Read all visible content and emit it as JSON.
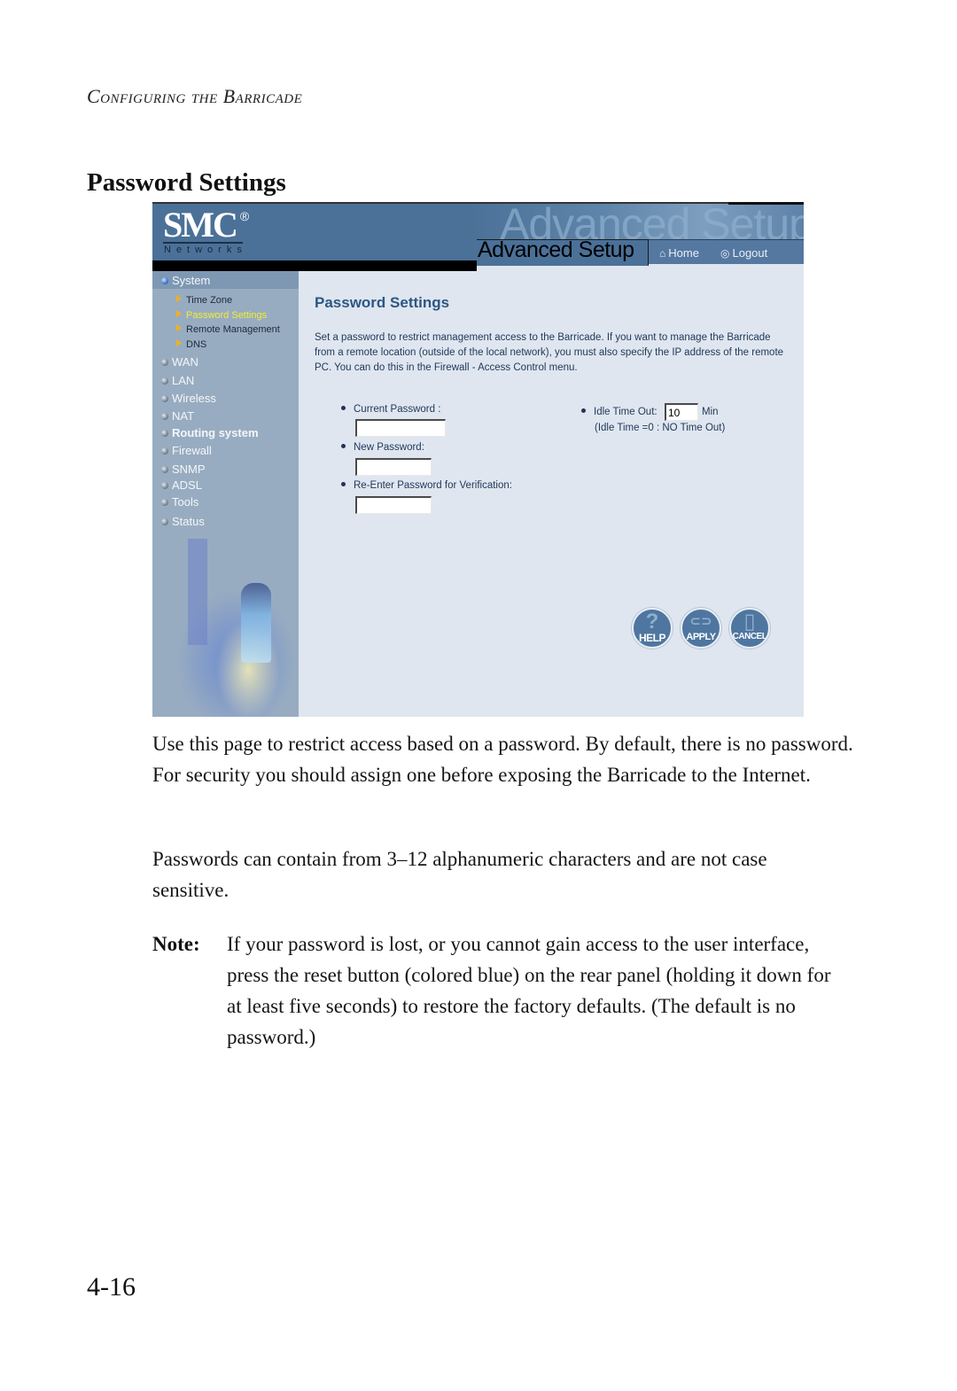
{
  "document": {
    "running_header": "Configuring the Barricade",
    "section_title": "Password Settings",
    "page_number": "4-16",
    "paragraphs": [
      "Use this page to restrict access based on a password. By default, there is no password. For security you should assign one before exposing the Barricade to the Internet.",
      "Passwords can contain from 3–12 alphanumeric characters and are not case sensitive."
    ],
    "note": {
      "label": "Note:",
      "text": "If your password is lost, or you cannot gain access to the user interface, press the reset button (colored blue) on the rear panel (holding it down for at least five seconds) to restore the factory defaults. (The default is no password.)"
    }
  },
  "screenshot": {
    "logo": {
      "brand": "SMC",
      "registered": "®",
      "subtitle": "Networks"
    },
    "banner_watermark": "Advanced Setup",
    "banner_title": "Advanced Setup",
    "top_nav": [
      {
        "label": "Home",
        "icon": "home-icon"
      },
      {
        "label": "Logout",
        "icon": "logout-icon"
      }
    ],
    "sidebar": {
      "sections": [
        {
          "label": "System",
          "bullet": "blue",
          "bold": false
        },
        {
          "label": "WAN",
          "bold": false
        },
        {
          "label": "LAN",
          "bold": false
        },
        {
          "label": "Wireless",
          "bold": false
        },
        {
          "label": "NAT",
          "bold": false
        },
        {
          "label": "Routing system",
          "bold": true
        },
        {
          "label": "Firewall",
          "bold": false
        },
        {
          "label": "SNMP",
          "bold": false
        },
        {
          "label": "ADSL",
          "bold": false
        },
        {
          "label": "Tools",
          "bold": false
        },
        {
          "label": "Status",
          "bold": false
        }
      ],
      "system_subitems": [
        {
          "label": "Time Zone",
          "active": false
        },
        {
          "label": "Password Settings",
          "active": true
        },
        {
          "label": "Remote Management",
          "active": false
        },
        {
          "label": "DNS",
          "active": false
        }
      ]
    },
    "content": {
      "title": "Password Settings",
      "description": "Set a password to restrict management access to the Barricade. If you want to manage the Barricade from a remote location (outside of the local network), you must also specify the IP address of the remote PC. You can do this in the Firewall - Access Control menu.",
      "fields": {
        "current_password": {
          "label": "Current Password :",
          "value": ""
        },
        "new_password": {
          "label": "New Password:",
          "value": ""
        },
        "reenter_password": {
          "label": "Re-Enter Password for Verification:",
          "value": ""
        }
      },
      "idle_timeout": {
        "label": "Idle Time Out:",
        "value": "10",
        "unit": "Min",
        "hint": "(Idle Time =0 : NO Time Out)"
      },
      "buttons": [
        {
          "label": "HELP",
          "glyph": "?"
        },
        {
          "label": "APPLY",
          "glyph": "⊂⊃"
        },
        {
          "label": "CANCEL",
          "glyph": "▯"
        }
      ]
    },
    "colors": {
      "banner": "#4b7198",
      "sidebar": "#98acc1",
      "content_bg": "#dfe6ef",
      "title_blue": "#2d5684",
      "active_link": "#f2ee2e"
    }
  }
}
